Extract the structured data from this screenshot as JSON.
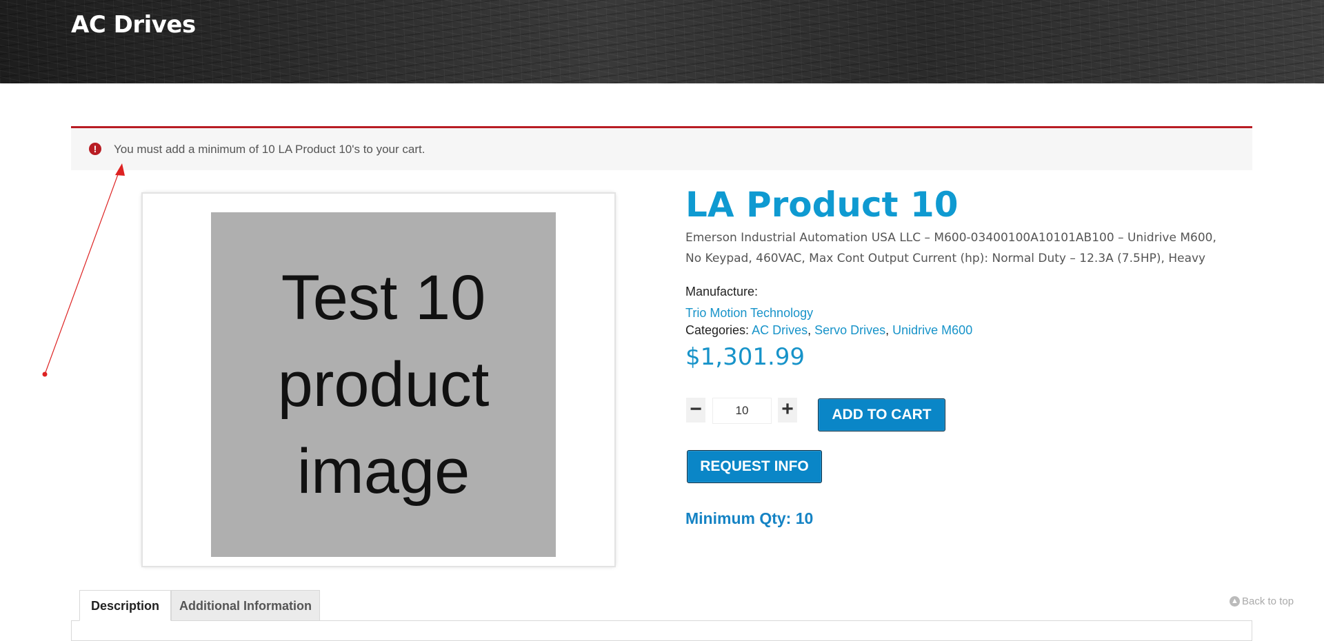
{
  "header": {
    "title": "AC Drives"
  },
  "notice": {
    "icon": "exclamation-icon",
    "message": "You must add a minimum of 10 LA Product 10's to your cart."
  },
  "product": {
    "image_text": [
      "Test 10",
      "product",
      "image"
    ],
    "title": "LA Product 10",
    "description": "Emerson Industrial Automation USA LLC – M600-03400100A10101AB100 – Unidrive M600, No Keypad, 460VAC, Max Cont Output Current (hp): Normal Duty – 12.3A (7.5HP), Heavy",
    "manufacture_label": "Manufacture:",
    "manufacturer": "Trio Motion Technology",
    "categories_label": "Categories:",
    "categories": [
      "AC Drives",
      "Servo Drives",
      "Unidrive M600"
    ],
    "price": "$1,301.99",
    "quantity": "10",
    "minus_symbol": "−",
    "plus_symbol": "+",
    "add_to_cart_label": "ADD TO CART",
    "request_info_label": "REQUEST INFO",
    "minimum_qty": "Minimum Qty: 10"
  },
  "tabs": [
    {
      "label": "Description",
      "active": true
    },
    {
      "label": "Additional Information",
      "active": false
    }
  ],
  "back_to_top": {
    "icon": "arrow-up-circle-icon",
    "label": "Back to top"
  },
  "colors": {
    "accent": "#0f9ad1",
    "button": "#0a86c7",
    "error": "#b81c23"
  }
}
